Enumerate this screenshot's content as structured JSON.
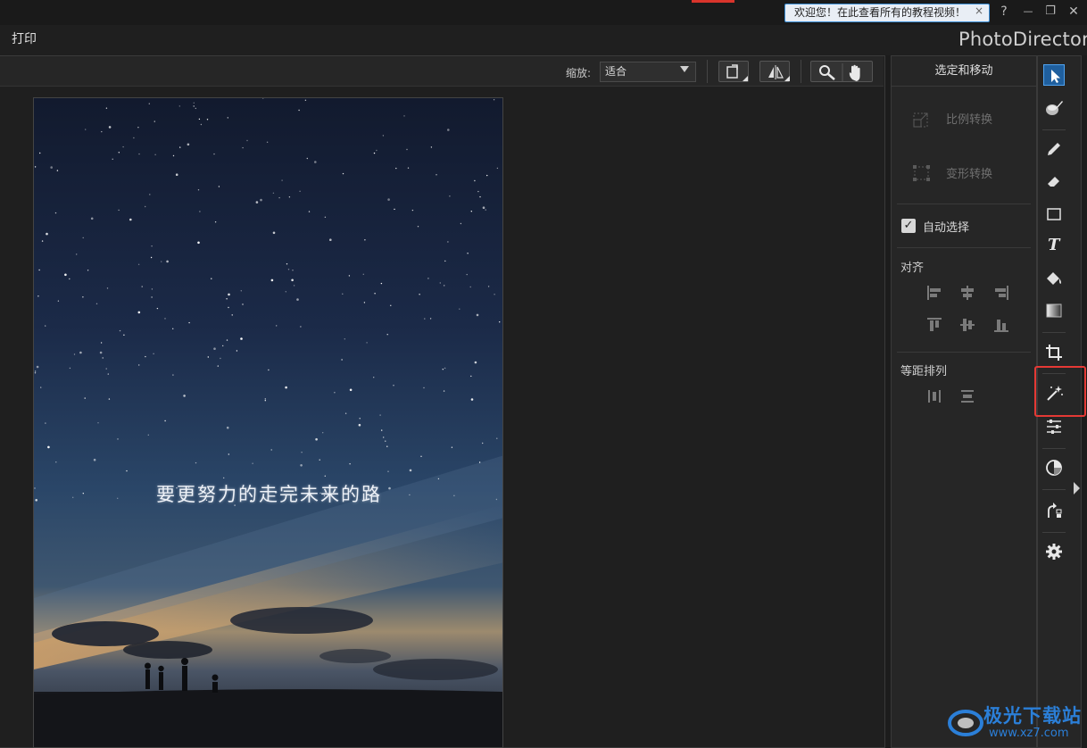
{
  "titlebar": {
    "welcome_text": "欢迎您！在此查看所有的教程视频！",
    "close_glyph": "×",
    "help_glyph": "?",
    "minimize_glyph": "—",
    "restore_glyph": "❐",
    "close_window_glyph": "✕"
  },
  "menu": {
    "print_label": "打印",
    "app_name": "PhotoDirector"
  },
  "canvas_toolbar": {
    "zoom_label": "缩放:",
    "zoom_value": "适合"
  },
  "photo": {
    "caption": "要更努力的走完未来的路"
  },
  "properties": {
    "title": "选定和移动",
    "scale_transform": "比例转换",
    "warp_transform": "变形转换",
    "auto_select_label": "自动选择",
    "auto_select_checked": true,
    "align_label": "对齐",
    "distribute_label": "等距排列"
  },
  "tools": [
    {
      "name": "select-move",
      "icon": "arrow-cursor-icon",
      "active": true
    },
    {
      "name": "object-brush",
      "icon": "brush-stack-icon",
      "active": false
    },
    {
      "name": "pencil",
      "icon": "pencil-icon",
      "active": false
    },
    {
      "name": "eraser",
      "icon": "eraser-icon",
      "active": false
    },
    {
      "name": "rectangle",
      "icon": "rectangle-icon",
      "active": false
    },
    {
      "name": "text",
      "icon": "text-icon",
      "active": false
    },
    {
      "name": "fill",
      "icon": "paint-bucket-icon",
      "active": false
    },
    {
      "name": "gradient",
      "icon": "gradient-icon",
      "active": false
    },
    {
      "name": "crop",
      "icon": "crop-icon",
      "active": false
    },
    {
      "name": "magic-wand",
      "icon": "magic-wand-icon",
      "active": false,
      "highlighted": true
    },
    {
      "name": "adjustments",
      "icon": "sliders-icon",
      "active": false
    },
    {
      "name": "effects",
      "icon": "circle-half-icon",
      "active": false
    },
    {
      "name": "transform-rotate",
      "icon": "rotate-icon",
      "active": false
    },
    {
      "name": "settings",
      "icon": "gear-icon",
      "active": false
    }
  ],
  "text_icon_glyph": "T",
  "checkmark_glyph": "✓",
  "watermark": {
    "line1": "极光下载站",
    "line2": "www.xz7.com"
  },
  "colors": {
    "accent": "#1f5f9e",
    "highlight_border": "#e53935",
    "watermark": "#2b7fd8"
  }
}
